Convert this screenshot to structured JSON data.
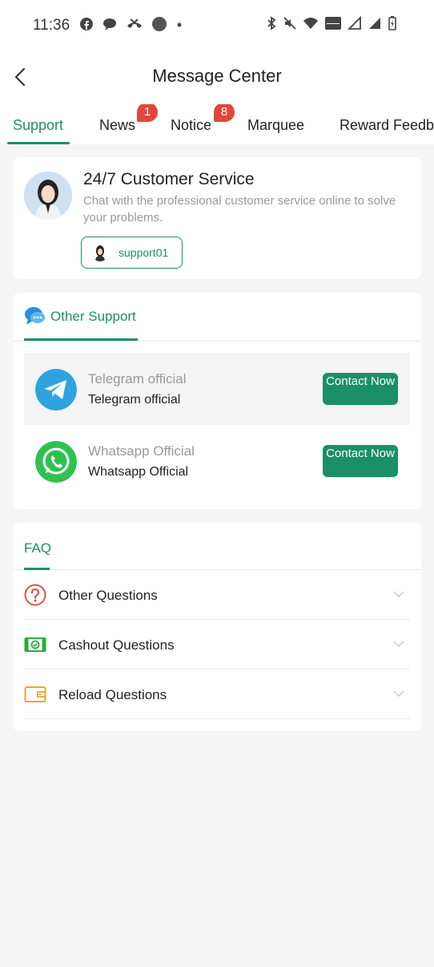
{
  "status_bar": {
    "time": "11:36"
  },
  "header": {
    "title": "Message Center"
  },
  "tabs": [
    {
      "label": "Support",
      "active": true
    },
    {
      "label": "News",
      "badge": "1"
    },
    {
      "label": "Notice",
      "badge": "8"
    },
    {
      "label": "Marquee"
    },
    {
      "label": "Reward Feedba"
    }
  ],
  "customer_service": {
    "title": "24/7 Customer Service",
    "description": "Chat with the professional customer service online to solve your problems.",
    "agent": "support01"
  },
  "other_support": {
    "title": "Other Support",
    "items": [
      {
        "title": "Telegram official",
        "subtitle": "Telegram official",
        "button": "Contact Now",
        "icon": "telegram-icon"
      },
      {
        "title": "Whatsapp Official",
        "subtitle": "Whatsapp Official",
        "button": "Contact Now",
        "icon": "whatsapp-icon"
      }
    ]
  },
  "faq": {
    "title": "FAQ",
    "items": [
      {
        "label": "Other Questions",
        "icon": "question-icon",
        "color": "#d9534f"
      },
      {
        "label": "Cashout Questions",
        "icon": "cash-icon",
        "color": "#2eaa3c"
      },
      {
        "label": "Reload Questions",
        "icon": "wallet-icon",
        "color": "#e8a82a"
      }
    ]
  },
  "colors": {
    "accent": "#1a8f68",
    "badge": "#e0473a",
    "background": "#f5f5f5"
  }
}
